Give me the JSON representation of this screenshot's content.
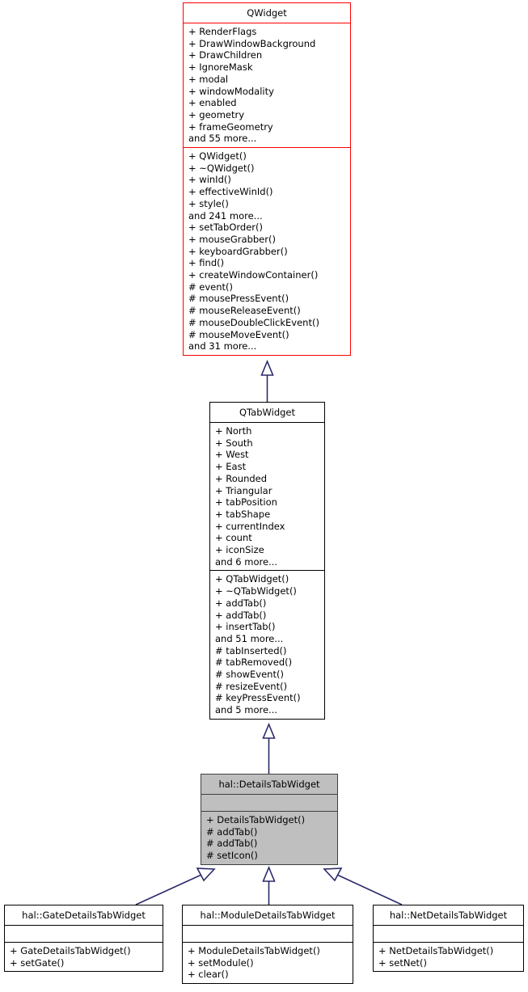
{
  "diagram": {
    "type": "uml-class-inheritance-diagram",
    "title": "hal::DetailsTabWidget inheritance diagram",
    "colors": {
      "base_class_border": "#ff0000",
      "class_border": "#000000",
      "highlight_fill": "#bfbfbf",
      "highlight_border": "#404040",
      "connector": "#2a2a6a",
      "background": "#ffffff"
    },
    "classes": [
      {
        "id": "qwidget",
        "name": "QWidget",
        "style": "accent",
        "attributes": [
          "+ RenderFlags",
          "+ DrawWindowBackground",
          "+ DrawChildren",
          "+ IgnoreMask",
          "+ modal",
          "+ windowModality",
          "+ enabled",
          "+ geometry",
          "+ frameGeometry",
          "and 55 more..."
        ],
        "methods": [
          "+ QWidget()",
          "+ ~QWidget()",
          "+ winId()",
          "+ effectiveWinId()",
          "+ style()",
          "and 241 more...",
          "+ setTabOrder()",
          "+ mouseGrabber()",
          "+ keyboardGrabber()",
          "+ find()",
          "+ createWindowContainer()",
          "# event()",
          "# mousePressEvent()",
          "# mouseReleaseEvent()",
          "# mouseDoubleClickEvent()",
          "# mouseMoveEvent()",
          "and 31 more..."
        ]
      },
      {
        "id": "qtabwidget",
        "name": "QTabWidget",
        "style": "normal",
        "attributes": [
          "+ North",
          "+ South",
          "+ West",
          "+ East",
          "+ Rounded",
          "+ Triangular",
          "+ tabPosition",
          "+ tabShape",
          "+ currentIndex",
          "+ count",
          "+ iconSize",
          "and 6 more..."
        ],
        "methods": [
          "+ QTabWidget()",
          "+ ~QTabWidget()",
          "+ addTab()",
          "+ addTab()",
          "+ insertTab()",
          "and 51 more...",
          "# tabInserted()",
          "# tabRemoved()",
          "# showEvent()",
          "# resizeEvent()",
          "# keyPressEvent()",
          "and 5 more..."
        ]
      },
      {
        "id": "detailstabwidget",
        "name": "hal::DetailsTabWidget",
        "style": "highlight",
        "attributes": [],
        "methods": [
          "+ DetailsTabWidget()",
          "# addTab()",
          "# addTab()",
          "# setIcon()"
        ]
      },
      {
        "id": "gatedetailstabwidget",
        "name": "hal::GateDetailsTabWidget",
        "style": "normal",
        "attributes": [],
        "methods": [
          "+ GateDetailsTabWidget()",
          "+ setGate()"
        ]
      },
      {
        "id": "moduledetailstabwidget",
        "name": "hal::ModuleDetailsTabWidget",
        "style": "normal",
        "attributes": [],
        "methods": [
          "+ ModuleDetailsTabWidget()",
          "+ setModule()",
          "+ clear()"
        ]
      },
      {
        "id": "netdetailstabwidget",
        "name": "hal::NetDetailsTabWidget",
        "style": "normal",
        "attributes": [],
        "methods": [
          "+ NetDetailsTabWidget()",
          "+ setNet()"
        ]
      }
    ],
    "edges": [
      {
        "from": "qtabwidget",
        "to": "qwidget",
        "kind": "inheritance"
      },
      {
        "from": "detailstabwidget",
        "to": "qtabwidget",
        "kind": "inheritance"
      },
      {
        "from": "gatedetailstabwidget",
        "to": "detailstabwidget",
        "kind": "inheritance"
      },
      {
        "from": "moduledetailstabwidget",
        "to": "detailstabwidget",
        "kind": "inheritance"
      },
      {
        "from": "netdetailstabwidget",
        "to": "detailstabwidget",
        "kind": "inheritance"
      }
    ]
  }
}
